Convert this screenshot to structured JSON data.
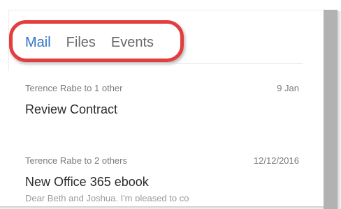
{
  "tabs": [
    {
      "label": "Mail",
      "active": true
    },
    {
      "label": "Files",
      "active": false
    },
    {
      "label": "Events",
      "active": false
    }
  ],
  "messages": [
    {
      "from": "Terence Rabe to 1 other",
      "date": "9 Jan",
      "subject": "Review Contract",
      "preview": ""
    },
    {
      "from": "Terence Rabe to 2 others",
      "date": "12/12/2016",
      "subject": "New Office 365 ebook",
      "preview": "Dear Beth and Joshua, I'm pleased to co"
    }
  ],
  "colors": {
    "accent": "#2f73c8",
    "highlight": "#e33d3d",
    "scrollbar": "#b2b2b2"
  }
}
